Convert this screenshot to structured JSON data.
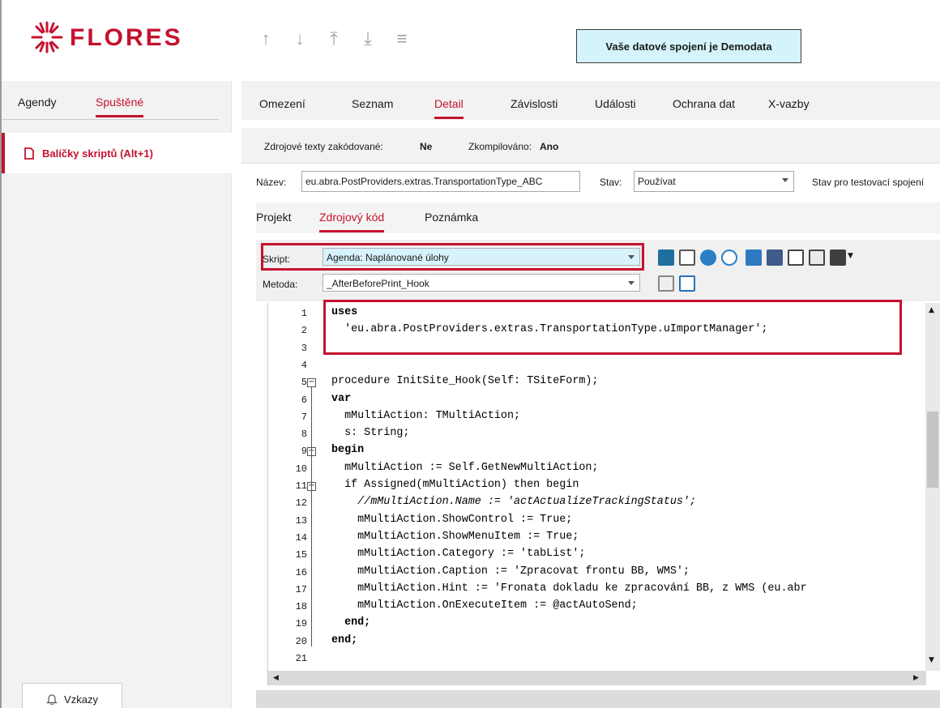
{
  "app": {
    "logo_text": "FLORES",
    "connection_badge": "Vaše datové spojení je Demodata"
  },
  "nav_arrows": [
    "↑",
    "↓",
    "⤒",
    "⤓",
    "≡"
  ],
  "sidebar": {
    "tabs": [
      {
        "label": "Agendy",
        "active": false
      },
      {
        "label": "Spuštěné",
        "active": true
      }
    ],
    "items": [
      {
        "label": "Balíčky skriptů (Alt+1)",
        "icon": "document-icon"
      }
    ],
    "footer_button": {
      "label": "Vzkazy",
      "icon": "bell-icon"
    }
  },
  "main_tabs": [
    {
      "label": "Omezení",
      "active": false
    },
    {
      "label": "Seznam",
      "active": false
    },
    {
      "label": "Detail",
      "active": true
    },
    {
      "label": "Závislosti",
      "active": false
    },
    {
      "label": "Události",
      "active": false
    },
    {
      "label": "Ochrana dat",
      "active": false
    },
    {
      "label": "X-vazby",
      "active": false
    }
  ],
  "status": {
    "encoded_label": "Zdrojové texty zakódované:",
    "encoded_value": "Ne",
    "compiled_label": "Zkompilováno:",
    "compiled_value": "Ano"
  },
  "form": {
    "name_label": "Název:",
    "name_value": "eu.abra.PostProviders.extras.TransportationType_ABC",
    "state_label": "Stav:",
    "state_value": "Používat",
    "test_state_label": "Stav pro testovací spojení"
  },
  "sub_tabs": [
    {
      "label": "Projekt",
      "active": false
    },
    {
      "label": "Zdrojový kód",
      "active": true
    },
    {
      "label": "Poznámka",
      "active": false
    }
  ],
  "script_panel": {
    "script_label": "Skript:",
    "script_value": "Agenda: Naplánované úlohy",
    "method_label": "Metoda:",
    "method_value": "_AfterBeforePrint_Hook",
    "toolbar_icons": [
      "binary-import-icon",
      "print-preview-icon",
      "search-icon",
      "find-replace-icon",
      "gear-icon",
      "note-icon",
      "note-alt-icon",
      "list-icon",
      "save-icon"
    ],
    "method_icons": [
      "page-icon",
      "page-alt-icon"
    ]
  },
  "code": {
    "lines": [
      {
        "n": "1",
        "text": "uses",
        "style": "kw"
      },
      {
        "n": "2",
        "text": "  'eu.abra.PostProviders.extras.TransportationType.uImportManager';",
        "style": ""
      },
      {
        "n": "3",
        "text": "",
        "style": ""
      },
      {
        "n": "4",
        "text": "",
        "style": ""
      },
      {
        "n": "5",
        "text": "procedure InitSite_Hook(Self: TSiteForm);",
        "style": "mixed"
      },
      {
        "n": "6",
        "text": "var",
        "style": "kw"
      },
      {
        "n": "7",
        "text": "  mMultiAction: TMultiAction;",
        "style": ""
      },
      {
        "n": "8",
        "text": "  s: String;",
        "style": ""
      },
      {
        "n": "9",
        "text": "begin",
        "style": "kw"
      },
      {
        "n": "10",
        "text": "  mMultiAction := Self.GetNewMultiAction;",
        "style": ""
      },
      {
        "n": "11",
        "text": "  if Assigned(mMultiAction) then begin",
        "style": "mixed"
      },
      {
        "n": "12",
        "text": "    //mMultiAction.Name := 'actActualizeTrackingStatus';",
        "style": "comment"
      },
      {
        "n": "13",
        "text": "    mMultiAction.ShowControl := True;",
        "style": ""
      },
      {
        "n": "14",
        "text": "    mMultiAction.ShowMenuItem := True;",
        "style": ""
      },
      {
        "n": "15",
        "text": "    mMultiAction.Category := 'tabList';",
        "style": ""
      },
      {
        "n": "16",
        "text": "    mMultiAction.Caption := 'Zpracovat frontu BB, WMS';",
        "style": ""
      },
      {
        "n": "17",
        "text": "    mMultiAction.Hint := 'Fronata dokladu ke zpracování BB, z WMS (eu.abr",
        "style": ""
      },
      {
        "n": "18",
        "text": "    mMultiAction.OnExecuteItem := @actAutoSend;",
        "style": ""
      },
      {
        "n": "19",
        "text": "  end;",
        "style": "kw"
      },
      {
        "n": "20",
        "text": "end;",
        "style": "kw"
      },
      {
        "n": "21",
        "text": "",
        "style": ""
      }
    ]
  },
  "colors": {
    "accent": "#c4122f",
    "badge_bg": "#d4f3fb",
    "highlight": "#d7f2fb"
  }
}
